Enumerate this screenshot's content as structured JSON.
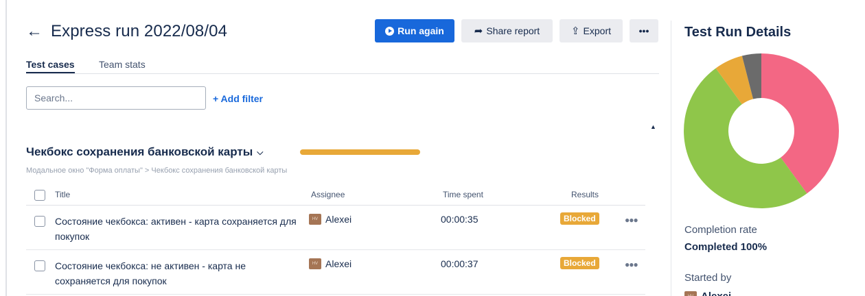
{
  "header": {
    "back_icon": "arrow-left-icon",
    "title": "Express run 2022/08/04",
    "run_again": "Run again",
    "share": "Share report",
    "export": "Export",
    "more": "•••"
  },
  "tabs": [
    {
      "label": "Test cases",
      "active": true
    },
    {
      "label": "Team stats",
      "active": false
    }
  ],
  "search": {
    "placeholder": "Search...",
    "value": ""
  },
  "add_filter": "+ Add filter",
  "suite": {
    "title": "Чекбокс сохранения банковской карты",
    "breadcrumb": "Модальное окно \"Форма оплаты\" > Чекбокс сохранения банковской карты",
    "progress_color": "#e8a838"
  },
  "table": {
    "columns": {
      "title": "Title",
      "assignee": "Assignee",
      "time": "Time spent",
      "results": "Results"
    },
    "rows": [
      {
        "title": "Состояние чекбокса: активен - карта сохраняется для покупок",
        "avatar": "HV",
        "assignee": "Alexei",
        "time": "00:00:35",
        "result": "Blocked"
      },
      {
        "title": "Состояние чекбокса: не активен - карта не сохраняется для покупок",
        "avatar": "HV",
        "assignee": "Alexei",
        "time": "00:00:37",
        "result": "Blocked"
      }
    ]
  },
  "side": {
    "title": "Test Run Details",
    "completion_label": "Completion rate",
    "completion_value": "Completed 100%",
    "started_label": "Started by",
    "started_avatar": "HV",
    "started_by": "Alexei"
  },
  "colors": {
    "primary": "#1868db",
    "blocked": "#e8a838",
    "donut_passed": "#8fc64a",
    "donut_failed": "#f36784",
    "donut_blocked": "#e8a838",
    "donut_skipped": "#6b6b6b"
  },
  "donut": [
    {
      "status": "failed",
      "fraction": 0.4,
      "color": "#f36784"
    },
    {
      "status": "passed",
      "fraction": 0.5,
      "color": "#8fc64a"
    },
    {
      "status": "blocked",
      "fraction": 0.06,
      "color": "#e8a838"
    },
    {
      "status": "skipped",
      "fraction": 0.04,
      "color": "#6b6b6b"
    }
  ]
}
